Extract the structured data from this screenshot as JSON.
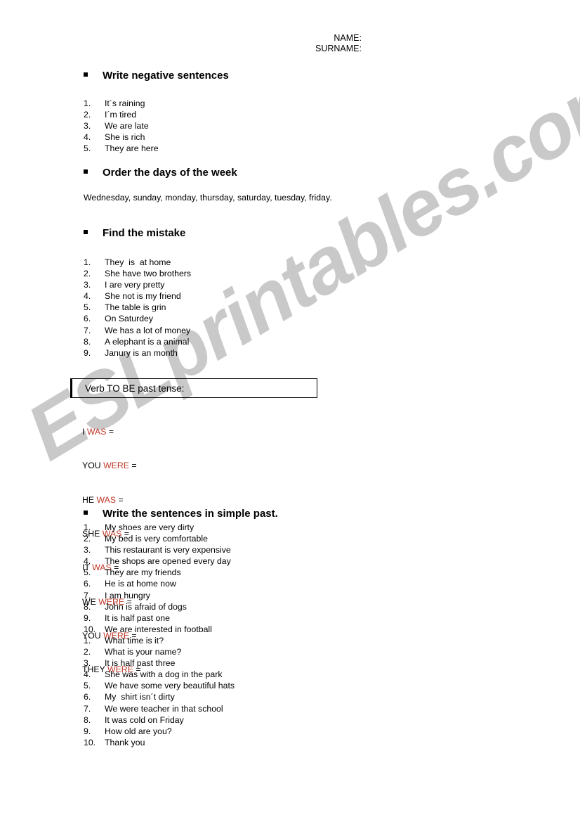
{
  "watermark": {
    "text": "ESLprintables.com",
    "color": "#c9c9c9"
  },
  "header": {
    "name_label": "NAME:",
    "surname_label": "SURNAME:"
  },
  "sections": {
    "negative": {
      "heading": "Write negative sentences",
      "items": [
        "It´s raining",
        "I´m tired",
        "We are late",
        "She is rich",
        "They are here"
      ]
    },
    "days": {
      "heading": "Order the days of the week",
      "text": "Wednesday, sunday, monday, thursday, saturday, tuesday, friday."
    },
    "mistake": {
      "heading": "Find the mistake",
      "items": [
        "They  is  at home",
        "She have two brothers",
        "I are very pretty",
        "She not is my friend",
        "The table is grin",
        "On Saturdey",
        "We has a lot of money",
        "A elephant is a animal",
        "Janury is an month"
      ]
    },
    "verb_to_be": {
      "box_title": "Verb TO BE past tense:",
      "accent_color": "#c0392b",
      "rows": [
        {
          "pronoun": "I",
          "verb": "WAS",
          "equals": "="
        },
        {
          "pronoun": "YOU",
          "verb": "WERE",
          "equals": "="
        },
        {
          "pronoun": "HE",
          "verb": "WAS",
          "equals": "="
        },
        {
          "pronoun": "SHE",
          "verb": "WAS",
          "equals": "="
        },
        {
          "pronoun": "IT",
          "verb": "WAS",
          "equals": "="
        },
        {
          "pronoun": "WE",
          "verb": "WERE",
          "equals": "="
        },
        {
          "pronoun": "YOU",
          "verb": "WERE",
          "equals": "="
        },
        {
          "pronoun": "THEY",
          "verb": "WERE",
          "equals": "="
        }
      ]
    },
    "simple_past": {
      "heading": "Write the sentences in simple past.",
      "items_first": [
        "My shoes are very dirty",
        "My bed is very comfortable",
        "This restaurant is very expensive",
        "The shops are opened every day",
        "They are my friends",
        "He is at home now",
        "I am hungry",
        "John is afraid of dogs",
        "It is half past one",
        "We are interested in football"
      ],
      "items_second": [
        "What time is it?",
        "What is your name?",
        "It is half past three",
        "She was with a dog in the park",
        "We have some very beautiful hats",
        "My  shirt isn´t dirty",
        "We were teacher in that school",
        "It was cold on Friday",
        "How old are you?",
        "Thank you"
      ]
    }
  }
}
